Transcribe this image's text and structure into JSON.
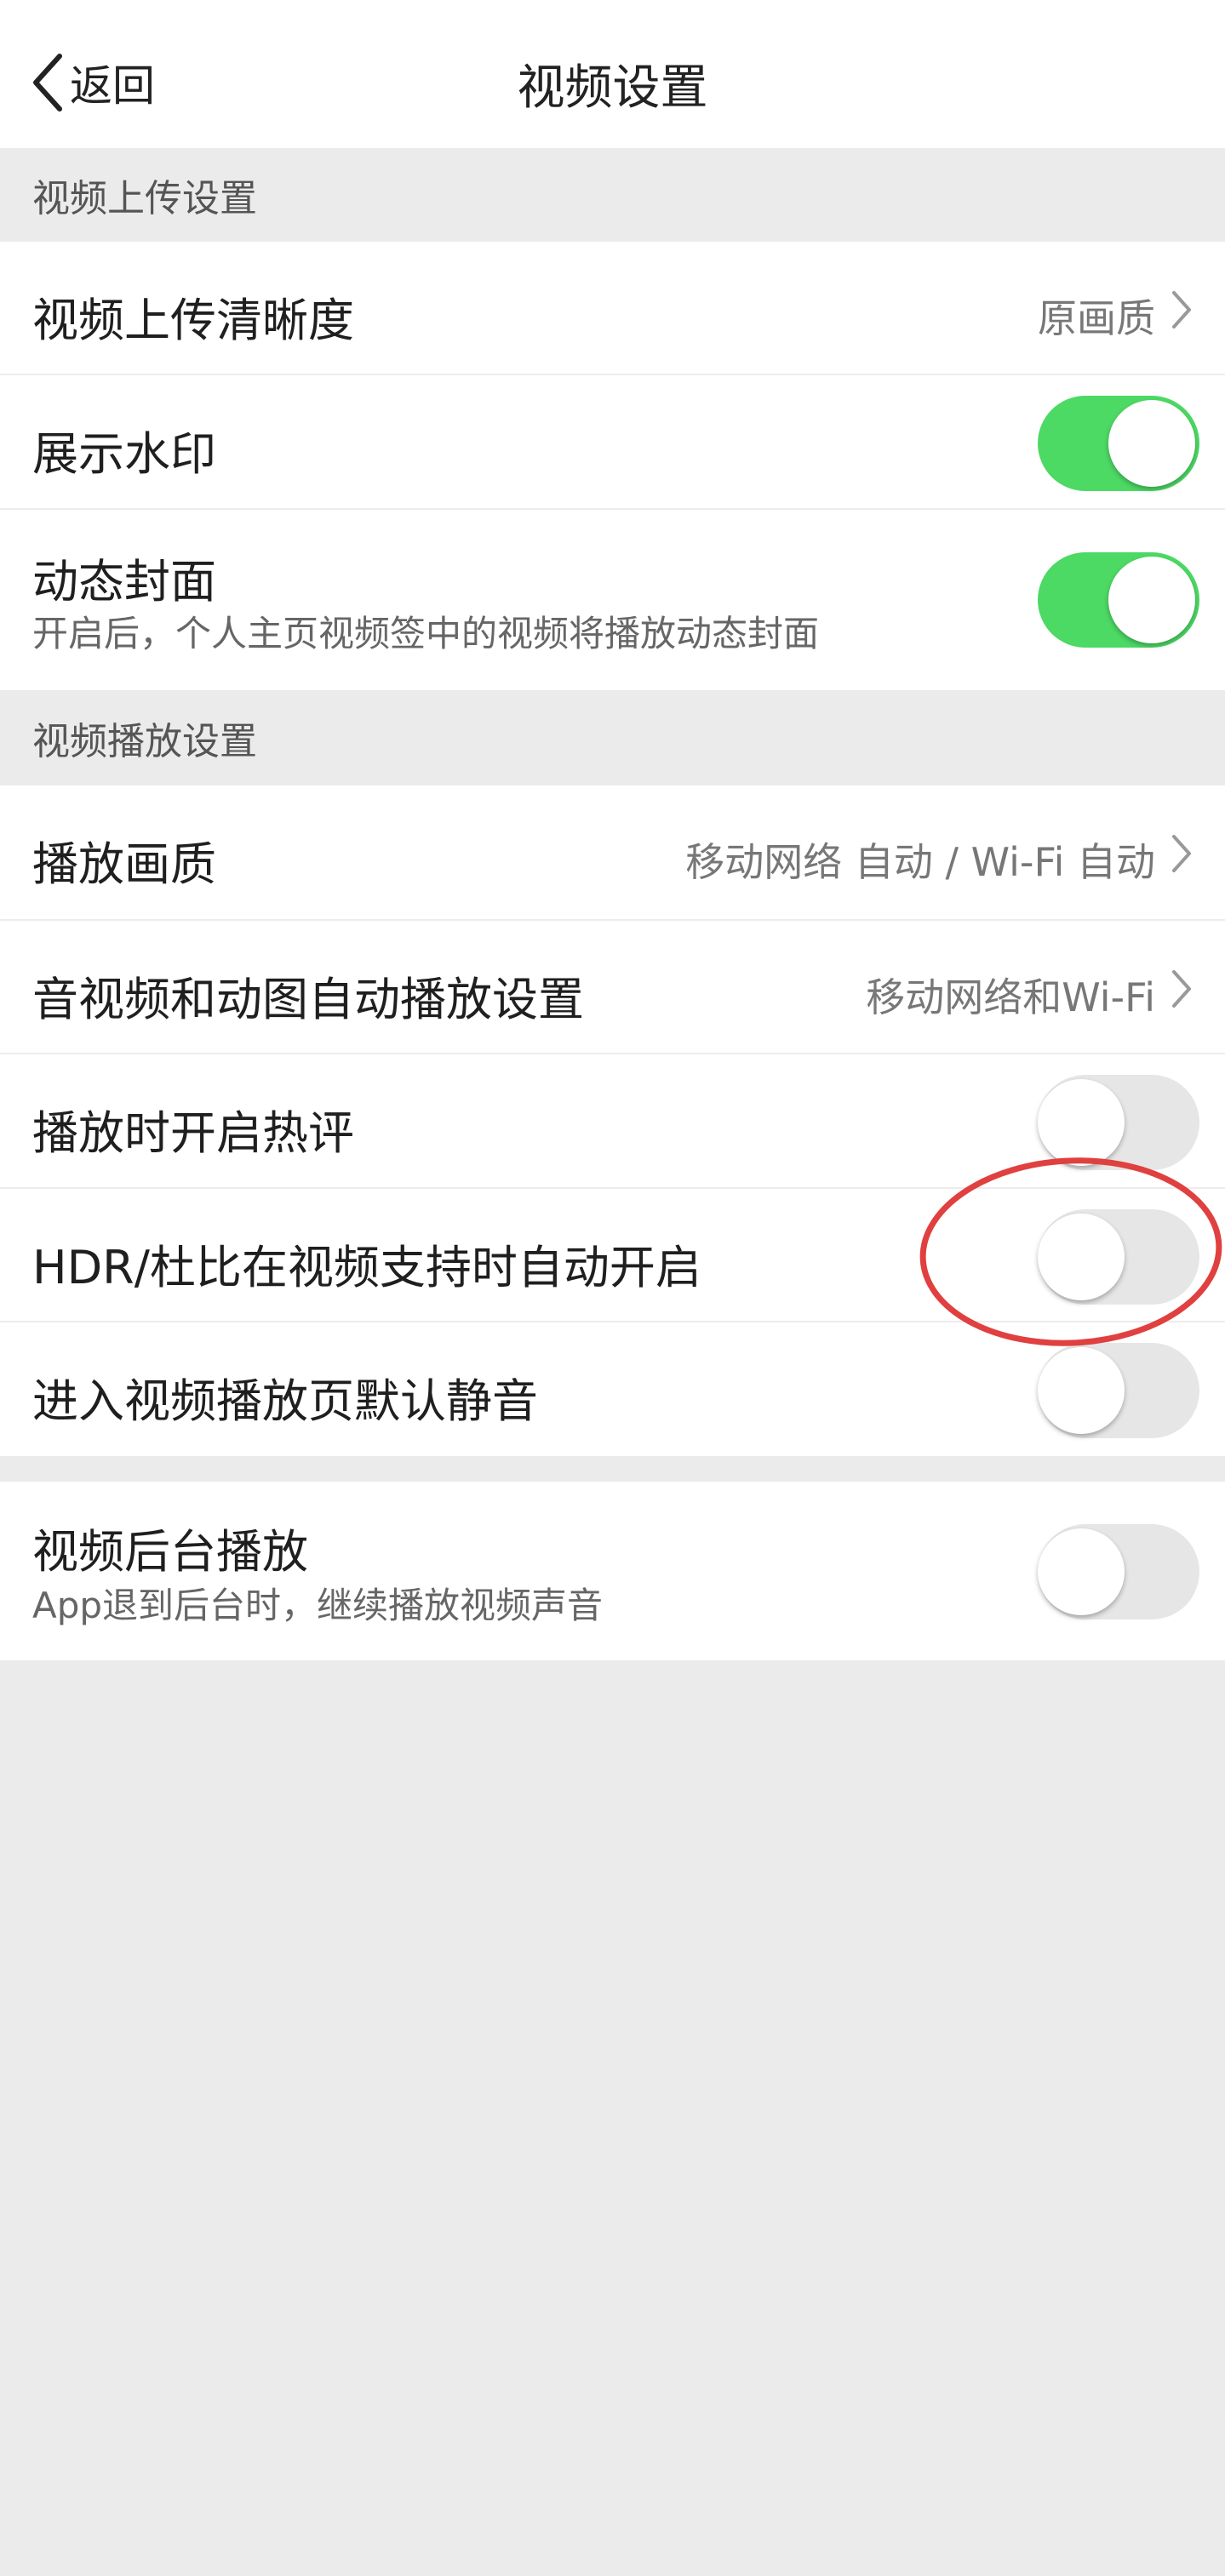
{
  "header": {
    "back_label": "返回",
    "title": "视频设置"
  },
  "sections": {
    "upload_header": "视频上传设置",
    "playback_header": "视频播放设置"
  },
  "upload": {
    "quality": {
      "label": "视频上传清晰度",
      "value": "原画质"
    },
    "watermark": {
      "label": "展示水印",
      "enabled": true
    },
    "dynamic_cover": {
      "label": "动态封面",
      "sub": "开启后，个人主页视频签中的视频将播放动态封面",
      "enabled": true
    }
  },
  "playback": {
    "quality": {
      "label": "播放画质",
      "value": "移动网络 自动 / Wi-Fi 自动"
    },
    "autoplay": {
      "label": "音视频和动图自动播放设置",
      "value": "移动网络和Wi-Fi"
    },
    "hot_comments": {
      "label": "播放时开启热评",
      "enabled": false
    },
    "hdr": {
      "label": "HDR/杜比在视频支持时自动开启",
      "enabled": false
    },
    "mute": {
      "label": "进入视频播放页默认静音",
      "enabled": false
    }
  },
  "background": {
    "label": "视频后台播放",
    "sub": "App退到后台时，继续播放视频声音",
    "enabled": false
  },
  "colors": {
    "toggle_on": "#4cd964",
    "toggle_off": "#e6e6e6",
    "highlight_ring": "#e0403f",
    "page_background": "#ebebeb"
  },
  "icons": {
    "back": "chevron-left-icon",
    "row_arrow": "chevron-right-icon"
  }
}
